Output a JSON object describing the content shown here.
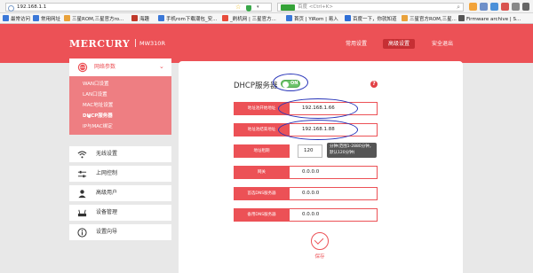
{
  "browser": {
    "url": "192.168.1.1",
    "search_placeholder": "百度 <Ctrl+K>",
    "bookmarks": [
      {
        "label": "最常访问",
        "color": "#3b78d8"
      },
      {
        "label": "常用网址",
        "color": "#3b78d8"
      },
      {
        "label": "三星ROM,三星官方ro...",
        "color": "#e9a23b"
      },
      {
        "label": "海趣",
        "color": "#c0392b"
      },
      {
        "label": "手机rom下载潮包_安...",
        "color": "#3b78d8"
      },
      {
        "label": "_刷机网 | 三星官方...",
        "color": "#e74c3c"
      },
      {
        "label": "首页 | YiRom | 易入",
        "color": "#3b78d8"
      },
      {
        "label": "百度一下，你就知道",
        "color": "#2f6fd6"
      },
      {
        "label": "三星官方ROM,三星...",
        "color": "#e9a23b"
      },
      {
        "label": "Firmware archive | S...",
        "color": "#555555"
      }
    ]
  },
  "header": {
    "logo": "MERCURY",
    "model": "MW310R",
    "nav": [
      {
        "label": "常用设置",
        "active": false
      },
      {
        "label": "高级设置",
        "active": true
      },
      {
        "label": "安全退出",
        "active": false
      }
    ]
  },
  "sidebar": {
    "network": {
      "label": "网络参数",
      "icon": "globe-icon",
      "sub_items": [
        {
          "label": "WAN口设置",
          "active": false
        },
        {
          "label": "LAN口设置",
          "active": false
        },
        {
          "label": "MAC地址设置",
          "active": false
        },
        {
          "label": "DHCP服务器",
          "active": true
        },
        {
          "label": "IP与MAC绑定",
          "active": false
        }
      ]
    },
    "items": [
      {
        "label": "无线设置",
        "icon": "wifi-icon"
      },
      {
        "label": "上网控制",
        "icon": "sliders-icon"
      },
      {
        "label": "高级用户",
        "icon": "user-icon"
      },
      {
        "label": "设备管理",
        "icon": "router-icon"
      },
      {
        "label": "设置向导",
        "icon": "info-icon"
      }
    ]
  },
  "dhcp": {
    "title": "DHCP服务器",
    "toggle": "ON",
    "help": "?",
    "fields": [
      {
        "label": "地址池开始地址",
        "value": "192.168.1.66"
      },
      {
        "label": "地址池结束地址",
        "value": "192.168.1.88"
      },
      {
        "label": "地址租期",
        "value": "120"
      },
      {
        "label": "网关",
        "value": "0.0.0.0"
      },
      {
        "label": "首选DNS服务器",
        "value": "0.0.0.0"
      },
      {
        "label": "备用DNS服务器",
        "value": "0.0.0.0"
      }
    ],
    "lease_hint": "分钟(范围1-2880分钟，默认120分钟)",
    "save_label": "保存"
  },
  "colors": {
    "brand_red": "#ec5156",
    "sidebar_active_bg": "#ee7e82",
    "toggle_green": "#6cc36b",
    "annotation_blue": "#2633b8"
  }
}
